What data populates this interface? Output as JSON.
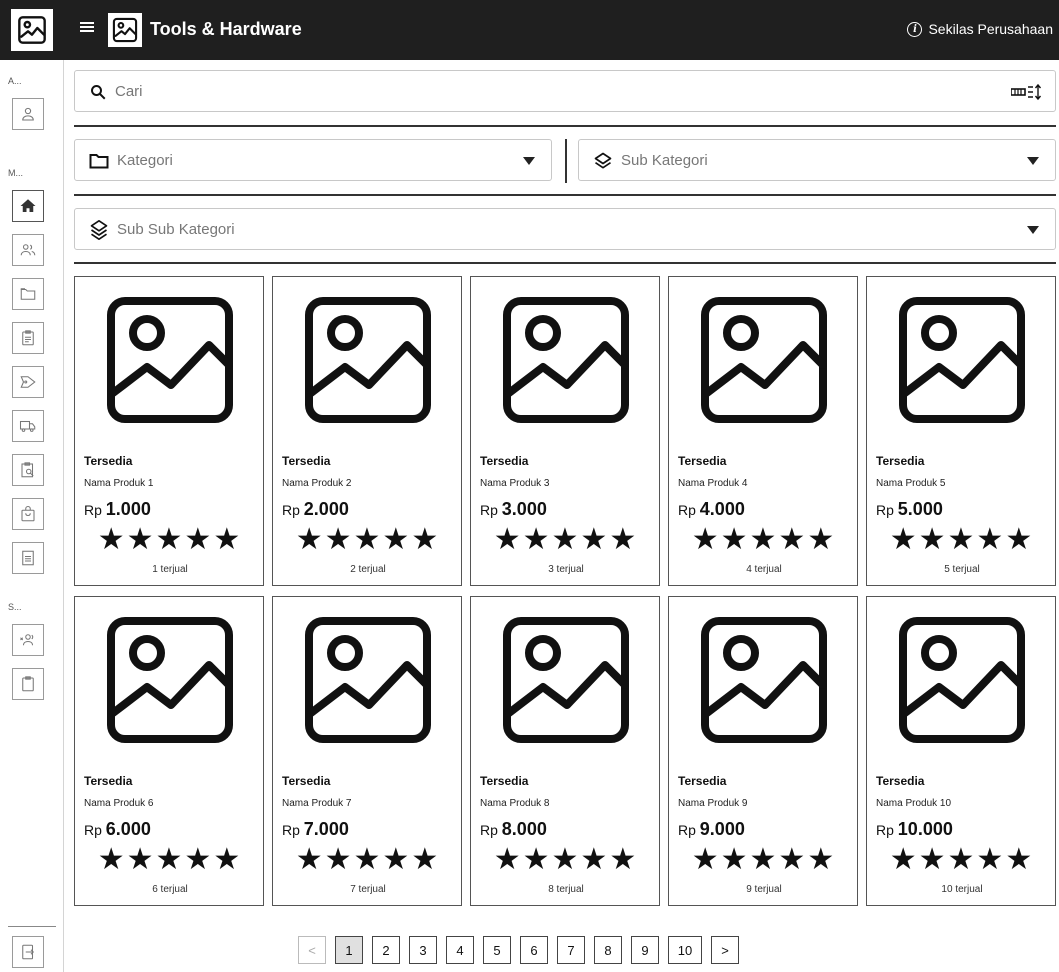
{
  "header": {
    "title": "Tools & Hardware",
    "company_overview": "Sekilas Perusahaan",
    "background_color": "#1f1f1f"
  },
  "sidebar": {
    "sections": [
      {
        "label": "A...",
        "items": [
          "user-icon"
        ]
      },
      {
        "label": "M...",
        "items": [
          "home-icon",
          "users-icon",
          "folder-icon",
          "clipboard-icon",
          "tag-icon",
          "truck-icon",
          "search-document-icon",
          "bag-icon",
          "document-icon"
        ]
      },
      {
        "label": "S...",
        "items": [
          "users-remove-icon",
          "clipboard-copy-icon"
        ]
      }
    ],
    "bottom_item": "logout-icon"
  },
  "search": {
    "placeholder": "Cari",
    "sort_icon": "sort-icon"
  },
  "filters": {
    "category": "Kategori",
    "subcategory": "Sub Kategori",
    "subsubcategory": "Sub Sub Kategori"
  },
  "products": [
    {
      "status": "Tersedia",
      "name": "Nama Produk 1",
      "currency": "Rp",
      "price": "1.000",
      "stars": "★★★★★",
      "rating": 5,
      "sold": "1 terjual"
    },
    {
      "status": "Tersedia",
      "name": "Nama Produk 2",
      "currency": "Rp",
      "price": "2.000",
      "stars": "★★★★★",
      "rating": 5,
      "sold": "2 terjual"
    },
    {
      "status": "Tersedia",
      "name": "Nama Produk 3",
      "currency": "Rp",
      "price": "3.000",
      "stars": "★★★★★",
      "rating": 5,
      "sold": "3 terjual"
    },
    {
      "status": "Tersedia",
      "name": "Nama Produk 4",
      "currency": "Rp",
      "price": "4.000",
      "stars": "★★★★★",
      "rating": 5,
      "sold": "4 terjual"
    },
    {
      "status": "Tersedia",
      "name": "Nama Produk 5",
      "currency": "Rp",
      "price": "5.000",
      "stars": "★★★★★",
      "rating": 5,
      "sold": "5 terjual"
    },
    {
      "status": "Tersedia",
      "name": "Nama Produk 6",
      "currency": "Rp",
      "price": "6.000",
      "stars": "★★★★★",
      "rating": 5,
      "sold": "6 terjual"
    },
    {
      "status": "Tersedia",
      "name": "Nama Produk 7",
      "currency": "Rp",
      "price": "7.000",
      "stars": "★★★★★",
      "rating": 5,
      "sold": "7 terjual"
    },
    {
      "status": "Tersedia",
      "name": "Nama Produk 8",
      "currency": "Rp",
      "price": "8.000",
      "stars": "★★★★★",
      "rating": 5,
      "sold": "8 terjual"
    },
    {
      "status": "Tersedia",
      "name": "Nama Produk 9",
      "currency": "Rp",
      "price": "9.000",
      "stars": "★★★★★",
      "rating": 5,
      "sold": "9 terjual"
    },
    {
      "status": "Tersedia",
      "name": "Nama Produk 10",
      "currency": "Rp",
      "price": "10.000",
      "stars": "★★★★★",
      "rating": 5,
      "sold": "10 terjual"
    }
  ],
  "pagination": {
    "prev": "<",
    "next": ">",
    "pages": [
      "1",
      "2",
      "3",
      "4",
      "5",
      "6",
      "7",
      "8",
      "9",
      "10"
    ],
    "current": "1"
  }
}
